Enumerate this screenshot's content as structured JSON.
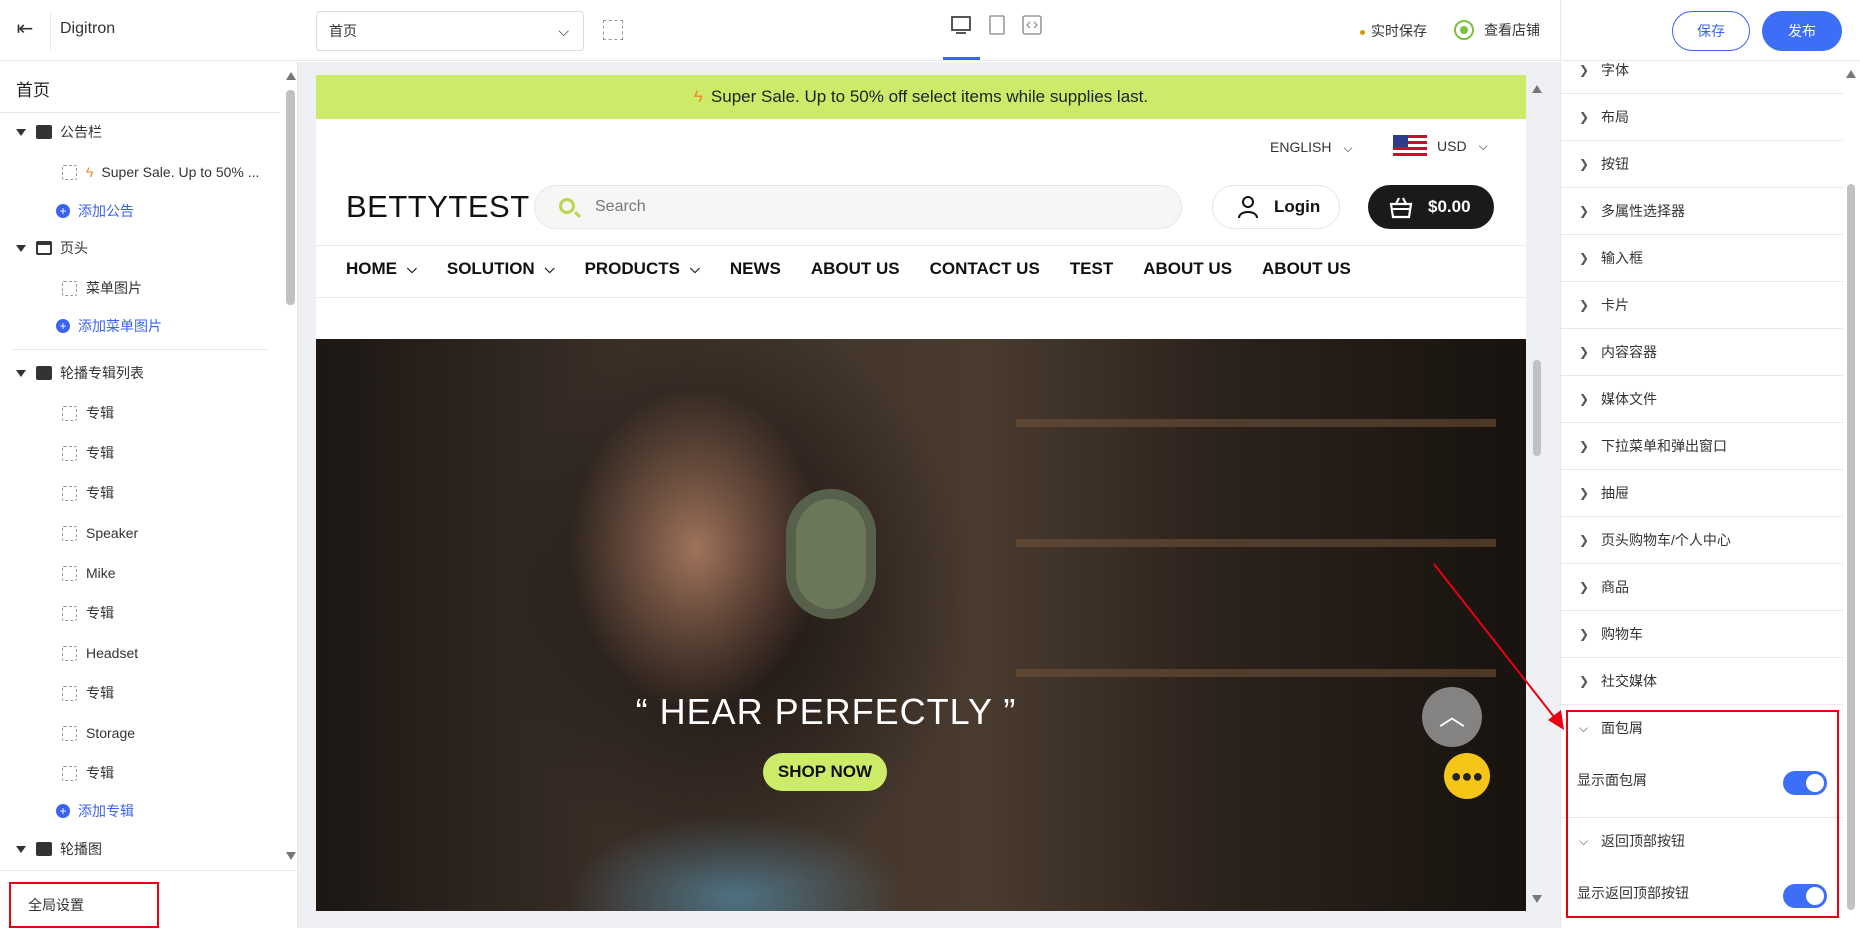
{
  "topbar": {
    "app_title": "Digitron",
    "page_select_value": "首页",
    "autosave_label": "实时保存",
    "view_store_label": "查看店铺",
    "save_label": "保存",
    "publish_label": "发布"
  },
  "left": {
    "title": "首页",
    "sections": [
      {
        "label": "公告栏"
      },
      {
        "label": "页头"
      },
      {
        "label": "轮播专辑列表"
      },
      {
        "label": "轮播图"
      }
    ],
    "announcement_item": "Super Sale. Up to 50% ...",
    "add_announcement": "添加公告",
    "menu_image_item": "菜单图片",
    "add_menu_image": "添加菜单图片",
    "album_items": [
      "专辑",
      "专辑",
      "专辑",
      "Speaker",
      "Mike",
      "专辑",
      "Headset",
      "专辑",
      "Storage",
      "专辑"
    ],
    "add_album": "添加专辑",
    "global_settings": "全局设置"
  },
  "site": {
    "announcement": "Super Sale. Up to 50% off select items while supplies last.",
    "language": "ENGLISH",
    "currency": "USD",
    "brand": "BETTYTEST",
    "search_placeholder": "Search",
    "login_label": "Login",
    "cart_total": "$0.00",
    "nav": [
      "HOME",
      "SOLUTION",
      "PRODUCTS",
      "NEWS",
      "ABOUT US",
      "CONTACT US",
      "TEST",
      "ABOUT US",
      "ABOUT US"
    ],
    "hero_title": "“ HEAR PERFECTLY ”",
    "hero_button": "SHOP NOW"
  },
  "right": {
    "accordion": [
      "字体",
      "布局",
      "按钮",
      "多属性选择器",
      "输入框",
      "卡片",
      "内容容器",
      "媒体文件",
      "下拉菜单和弹出窗口",
      "抽屉",
      "页头购物车/个人中心",
      "商品",
      "购物车",
      "社交媒体"
    ],
    "breadcrumb_section": "面包屑",
    "show_breadcrumb": "显示面包屑",
    "back_to_top_section": "返回顶部按钮",
    "show_back_to_top": "显示返回顶部按钮",
    "show_breadcrumb_on": true,
    "show_back_to_top_on": true
  },
  "colors": {
    "accent": "#3d6ef7",
    "announcement_bg": "#cbeb69",
    "highlight": "#e60012"
  }
}
